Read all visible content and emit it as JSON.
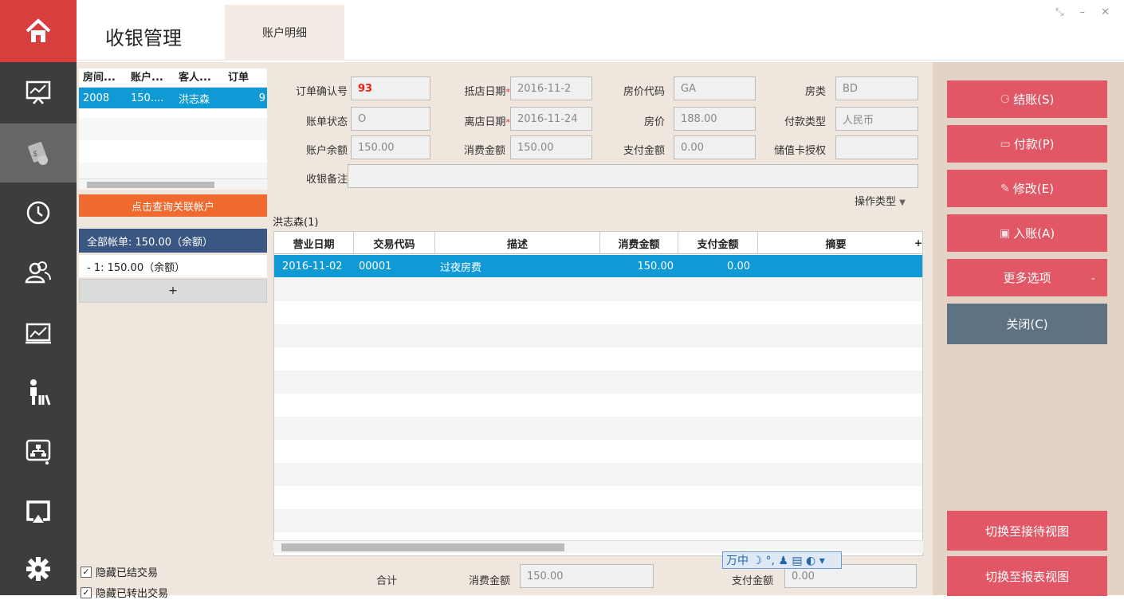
{
  "header": {
    "title": "收银管理",
    "tab": "账户明细",
    "window_controls": "⤡ – ✕"
  },
  "left": {
    "columns": [
      "房间...",
      "账户...",
      "客人...",
      "订单"
    ],
    "row": [
      "2008",
      "150....",
      "洪志森",
      "9"
    ],
    "query_button": "点击查询关联帐户",
    "all_accounts": "全部帐单: 150.00（余额）",
    "account_row": "-    1: 150.00（余额）",
    "add": "+",
    "hide_settled": "隐藏已结交易",
    "hide_transferred": "隐藏已转出交易"
  },
  "form": {
    "order_no_label": "订单确认号",
    "order_no": "93",
    "arrival_label": "抵店日期",
    "arrival": "2016-11-2",
    "rate_code_label": "房价代码",
    "rate_code": "GA",
    "room_type_label": "房类",
    "room_type": "BD",
    "status_label": "账单状态",
    "status": "O",
    "departure_label": "离店日期",
    "departure": "2016-11-24",
    "rate_label": "房价",
    "rate": "188.00",
    "pay_type_label": "付款类型",
    "pay_type": "人民币",
    "balance_label": "账户余额",
    "balance": "150.00",
    "consume_label": "消费金额",
    "consume": "150.00",
    "paid_label": "支付金额",
    "paid": "0.00",
    "card_auth_label": "储值卡授权",
    "card_auth": "",
    "remark_label": "收银备注",
    "remark": "",
    "required_mark": "*",
    "op_type": "操作类型"
  },
  "grid": {
    "guest_label": "洪志森(1)",
    "columns": [
      "营业日期",
      "交易代码",
      "描述",
      "消费金额",
      "支付金额",
      "摘要"
    ],
    "plus": "+",
    "row": {
      "date": "2016-11-02",
      "code": "00001",
      "desc": "过夜房费",
      "consume": "150.00",
      "paid": "0.00"
    }
  },
  "footer": {
    "total": "合计",
    "consume_label": "消费金额",
    "consume": "150.00",
    "paid_label": "支付金额",
    "paid": "0.00",
    "ime": "万中 ☽ °, ♟ ▤ ◐ ▾"
  },
  "actions": {
    "checkout": "结账(S)",
    "payment": "付款(P)",
    "modify": "修改(E)",
    "post": "入账(A)",
    "more": "更多选项",
    "close": "关闭(C)",
    "switch_reception": "切换至接待视图",
    "switch_report": "切换至报表视图"
  },
  "colors": {
    "accent_red": "#e15765",
    "blue": "#0f9ad6",
    "navy": "#3a5783",
    "orange": "#f06a30"
  }
}
